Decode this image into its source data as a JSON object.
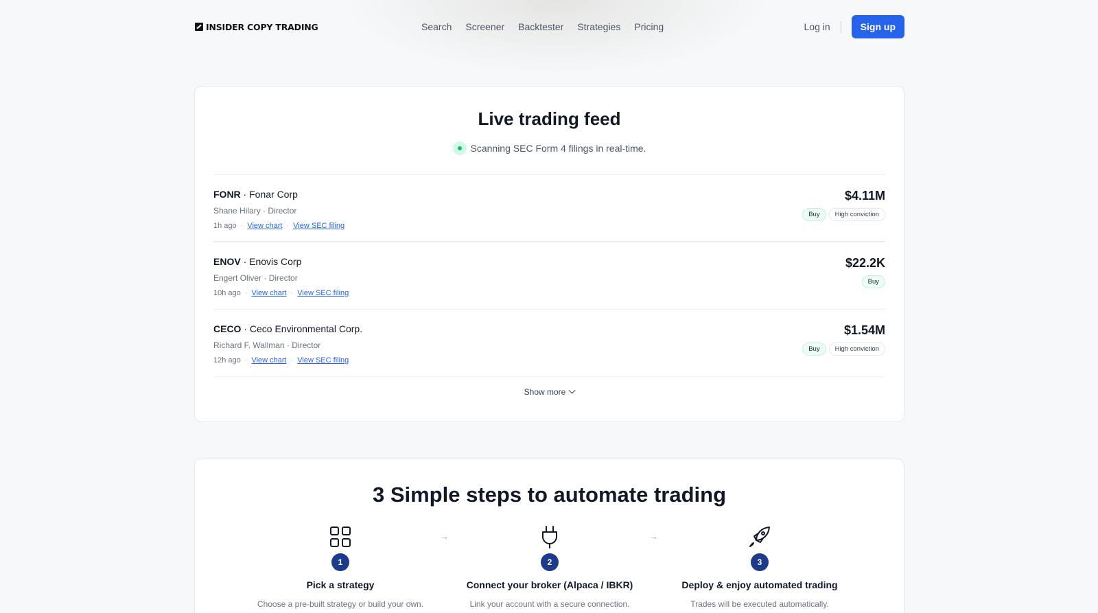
{
  "header": {
    "brand": "INSIDER COPY TRADING",
    "nav": [
      "Search",
      "Screener",
      "Backtester",
      "Strategies",
      "Pricing"
    ],
    "login": "Log in",
    "signup": "Sign up",
    "accent_color": "#2563eb"
  },
  "feed": {
    "title": "Live trading feed",
    "subtitle": "Scanning SEC Form 4 filings in real-time.",
    "rows": [
      {
        "ticker": "FONR",
        "company": " · Fonar Corp",
        "person": "Shane Hilary · Director",
        "time": "1h ago",
        "chart_link": "View chart",
        "filing_link": "View SEC filing",
        "amount": "$4.11M",
        "badge_buy": "Buy",
        "badge_conviction": "High conviction"
      },
      {
        "ticker": "ENOV",
        "company": " · Enovis Corp",
        "person": "Engert Oliver · Director",
        "time": "10h ago",
        "chart_link": "View chart",
        "filing_link": "View SEC filing",
        "amount": "$22.2K",
        "badge_buy": "Buy",
        "badge_conviction": ""
      },
      {
        "ticker": "CECO",
        "company": " · Ceco Environmental Corp.",
        "person": "Richard F. Wallman · Director",
        "time": "12h ago",
        "chart_link": "View chart",
        "filing_link": "View SEC filing",
        "amount": "$1.54M",
        "badge_buy": "Buy",
        "badge_conviction": "High conviction"
      }
    ],
    "show_more": "Show more"
  },
  "steps": {
    "title": "3 Simple steps to automate trading",
    "items": [
      {
        "number": "1",
        "icon": "grid-icon",
        "title": "Pick a strategy",
        "desc": "Choose a pre-built strategy or build your own."
      },
      {
        "number": "2",
        "icon": "plug-icon",
        "title": "Connect your broker (Alpaca / IBKR)",
        "desc": "Link your account with a secure connection."
      },
      {
        "number": "3",
        "icon": "rocket-icon",
        "title": "Deploy & enjoy automated trading",
        "desc": "Trades will be executed automatically."
      }
    ],
    "arrow": "→"
  }
}
